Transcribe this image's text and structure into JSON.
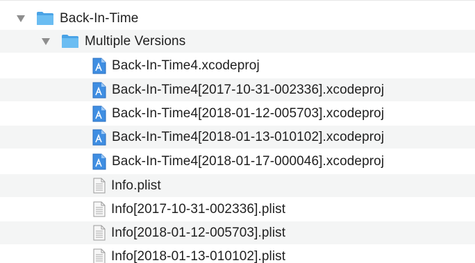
{
  "window": {
    "rows": [
      {
        "kind": "folder",
        "label": "Back-In-Time",
        "level": 0,
        "expanded": true,
        "icon": "folder-icon"
      },
      {
        "kind": "folder",
        "label": "Multiple Versions",
        "level": 1,
        "expanded": true,
        "icon": "folder-icon"
      },
      {
        "kind": "xcodeproj",
        "label": "Back-In-Time4.xcodeproj",
        "level": 2,
        "icon": "xcodeproj-icon"
      },
      {
        "kind": "xcodeproj",
        "label": "Back-In-Time4[2017-10-31-002336].xcodeproj",
        "level": 2,
        "icon": "xcodeproj-icon"
      },
      {
        "kind": "xcodeproj",
        "label": "Back-In-Time4[2018-01-12-005703].xcodeproj",
        "level": 2,
        "icon": "xcodeproj-icon"
      },
      {
        "kind": "xcodeproj",
        "label": "Back-In-Time4[2018-01-13-010102].xcodeproj",
        "level": 2,
        "icon": "xcodeproj-icon"
      },
      {
        "kind": "xcodeproj",
        "label": "Back-In-Time4[2018-01-17-000046].xcodeproj",
        "level": 2,
        "icon": "xcodeproj-icon"
      },
      {
        "kind": "plist",
        "label": "Info.plist",
        "level": 2,
        "icon": "plist-icon"
      },
      {
        "kind": "plist",
        "label": "Info[2017-10-31-002336].plist",
        "level": 2,
        "icon": "plist-icon"
      },
      {
        "kind": "plist",
        "label": "Info[2018-01-12-005703].plist",
        "level": 2,
        "icon": "plist-icon"
      },
      {
        "kind": "plist",
        "label": "Info[2018-01-13-010102].plist",
        "level": 2,
        "icon": "plist-icon"
      }
    ]
  },
  "colors": {
    "folder": "#5bb1ea",
    "xcode_blue": "#2f7fd8",
    "stripe": "#f4f5f5",
    "disclosure": "#8e8e8e"
  }
}
